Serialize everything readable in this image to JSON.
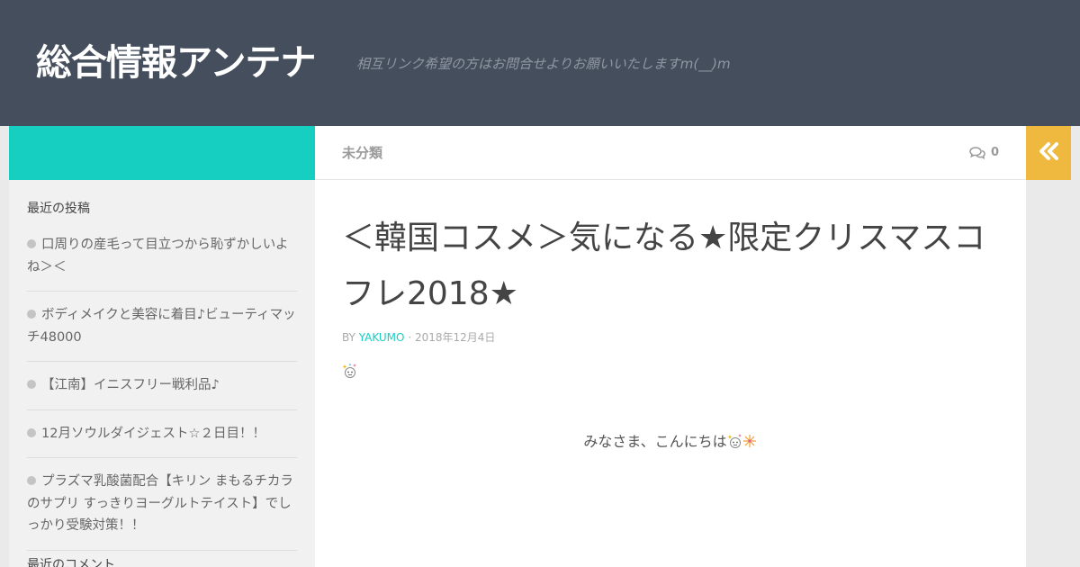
{
  "header": {
    "site_title": "総合情報アンテナ",
    "tagline": "相互リンク希望の方はお問合せよりお願いいたしますm(__)m"
  },
  "topbar": {
    "category": "未分類",
    "comment_count": "0"
  },
  "sidebar": {
    "recent_posts_title": "最近の投稿",
    "recent_posts": [
      "口周りの産毛って目立つから恥ずかしいよね＞＜",
      "ボディメイクと美容に着目♪ビューティマッチ48000",
      "【江南】イニスフリー戦利品♪",
      "12月ソウルダイジェスト☆２日目！！",
      "プラズマ乳酸菌配合【キリン まもるチカラのサプリ すっきりヨーグルトテイスト】でしっかり受験対策！！"
    ],
    "recent_comments_title": "最近のコメント"
  },
  "post": {
    "title": "＜韓国コスメ＞気になる★限定クリスマスコフレ2018★",
    "by": "BY",
    "author": "YAKUMO",
    "separator": "·",
    "date": "2018年12月4日",
    "greeting": "みなさま、こんにちは"
  },
  "colors": {
    "header_bg": "#454e5c",
    "accent_teal": "#16cfc1",
    "accent_yellow": "#efb93f"
  },
  "icons": {
    "comment": "comment-bubbles-icon",
    "collapse": "double-chevron-left-icon",
    "bullet": "clock-icon",
    "emoji": "sparkle-face-icon"
  }
}
